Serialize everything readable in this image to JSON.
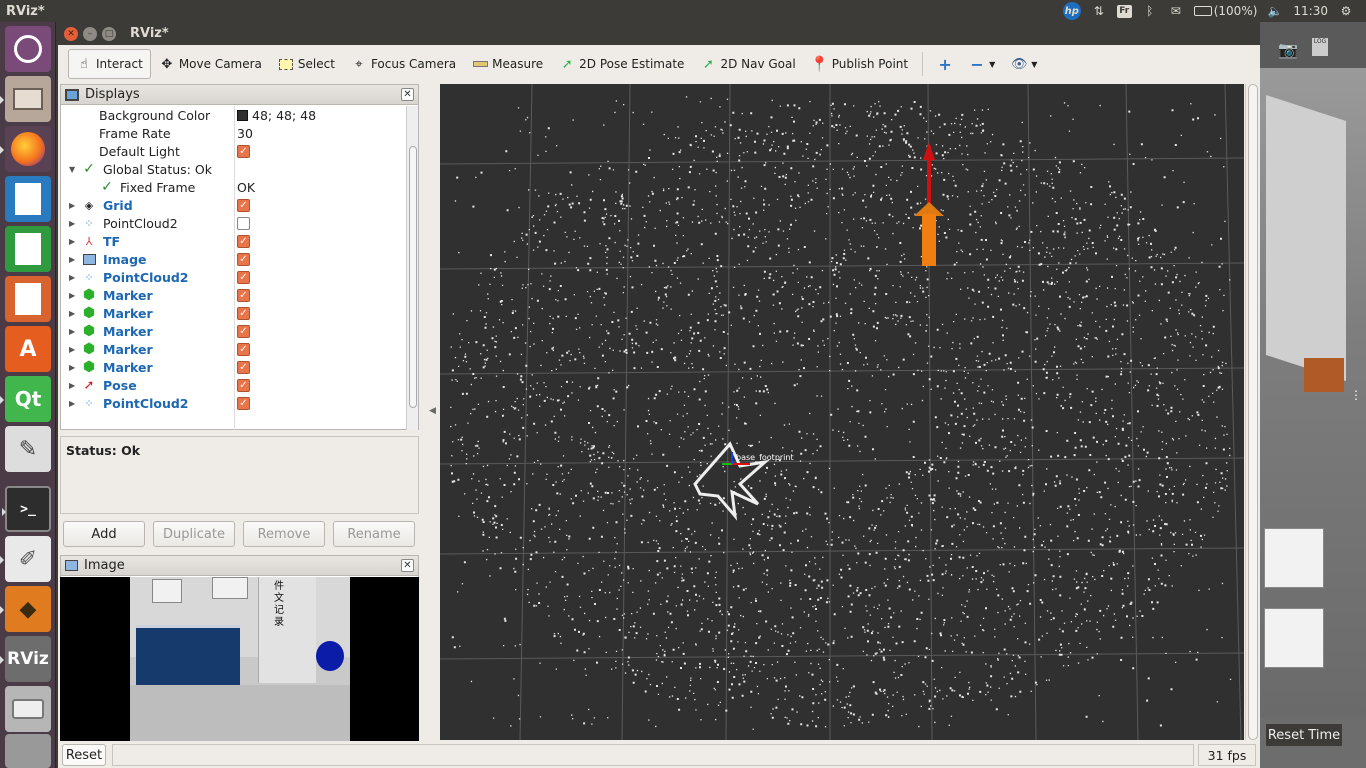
{
  "topbar": {
    "app_name": "RViz*",
    "keyboard_layout": "Fr",
    "battery": "(100%)",
    "clock": "11:30"
  },
  "launcher": {
    "items": [
      "ubuntu-dash-icon",
      "files-icon",
      "firefox-icon",
      "writer-icon",
      "calc-icon",
      "impress-icon",
      "software-center-icon",
      "qt-creator-icon",
      "text-editor-icon",
      "terminal-icon",
      "gedit-icon",
      "blender-icon",
      "rviz-icon",
      "disk-icon",
      "trash-icon"
    ],
    "rviz_label": "RViz"
  },
  "window": {
    "title": "RViz*"
  },
  "toolbar": {
    "interact": "Interact",
    "move_camera": "Move Camera",
    "select": "Select",
    "focus_camera": "Focus Camera",
    "measure": "Measure",
    "pose_estimate": "2D Pose Estimate",
    "nav_goal": "2D Nav Goal",
    "publish_point": "Publish Point"
  },
  "displays": {
    "title": "Displays",
    "rows": [
      {
        "name": "Background Color",
        "value": "48; 48; 48",
        "swatch": "#303030"
      },
      {
        "name": "Frame Rate",
        "value": "30"
      },
      {
        "name": "Default Light",
        "checked": true
      },
      {
        "name": "Global Status: Ok"
      },
      {
        "name": "Fixed Frame",
        "value": "OK"
      },
      {
        "name": "Grid",
        "checked": true
      },
      {
        "name": "PointCloud2",
        "checked": false
      },
      {
        "name": "TF",
        "checked": true
      },
      {
        "name": "Image",
        "checked": true
      },
      {
        "name": "PointCloud2",
        "checked": true
      },
      {
        "name": "Marker",
        "checked": true
      },
      {
        "name": "Marker",
        "checked": true
      },
      {
        "name": "Marker",
        "checked": true
      },
      {
        "name": "Marker",
        "checked": true
      },
      {
        "name": "Marker",
        "checked": true
      },
      {
        "name": "Pose",
        "checked": true
      },
      {
        "name": "PointCloud2",
        "checked": true
      }
    ],
    "status": "Status: Ok",
    "buttons": {
      "add": "Add",
      "duplicate": "Duplicate",
      "remove": "Remove",
      "rename": "Rename"
    }
  },
  "image_panel": {
    "title": "Image",
    "sign_text": "件文记录"
  },
  "viewport": {
    "frame_label": "base_footprint",
    "arrow_color": "#f07f0f",
    "axis_color": "#e01010"
  },
  "bottom": {
    "reset": "Reset",
    "fps": "31 fps"
  },
  "gazebo": {
    "reset_time": "Reset Time"
  },
  "colors": {
    "accent_orange": "#e8764a",
    "link_blue": "#1d67b3",
    "launcher_bg": "#4a3b47"
  }
}
